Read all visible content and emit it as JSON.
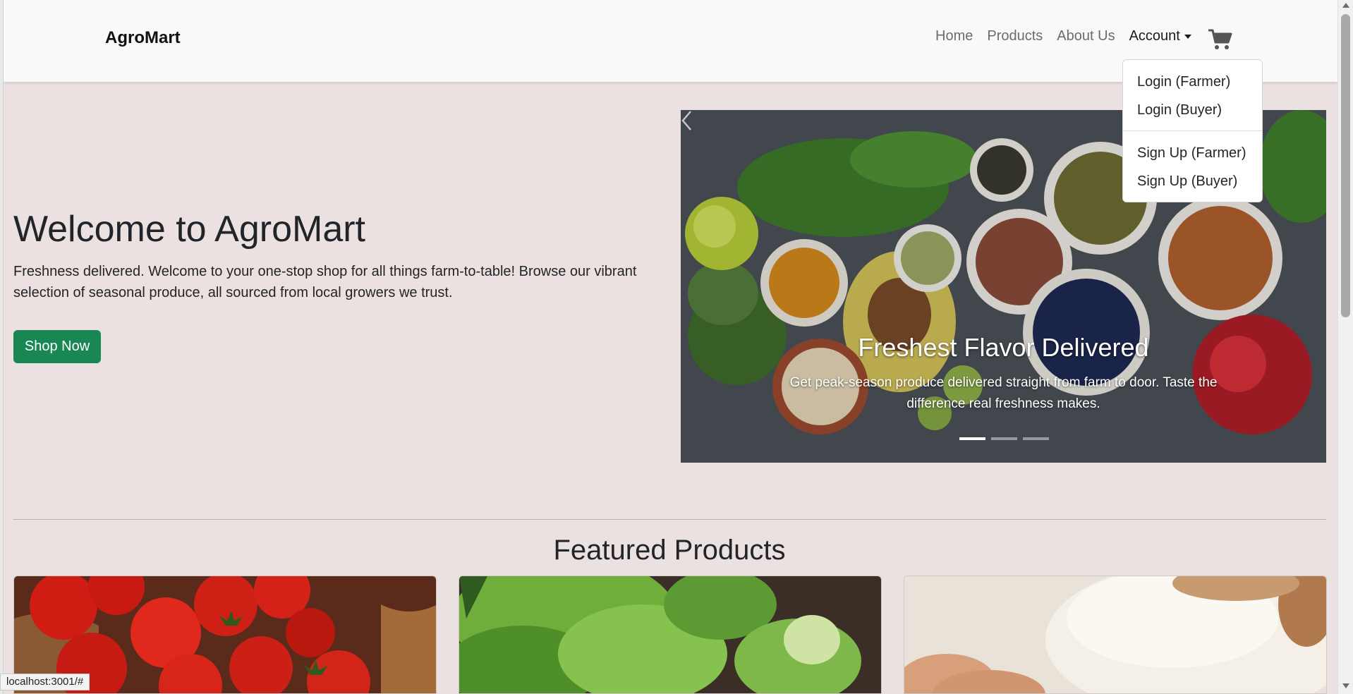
{
  "navbar": {
    "brand": "AgroMart",
    "links": [
      {
        "label": "Home"
      },
      {
        "label": "Products"
      },
      {
        "label": "About Us"
      },
      {
        "label": "Account"
      }
    ],
    "cart_icon": "cart-icon"
  },
  "account_menu": {
    "items": [
      {
        "label": "Login (Farmer)"
      },
      {
        "label": "Login (Buyer)"
      },
      {
        "label": "Sign Up (Farmer)"
      },
      {
        "label": "Sign Up (Buyer)"
      }
    ]
  },
  "hero": {
    "title": "Welcome to AgroMart",
    "text": "Freshness delivered. Welcome to your one-stop shop for all things farm-to-table! Browse our vibrant selection of seasonal produce, all sourced from local growers we trust.",
    "button_label": "Shop Now"
  },
  "carousel": {
    "caption_title": "Freshest Flavor Delivered",
    "caption_text": "Get peak-season produce delivered straight from farm to door. Taste the difference real freshness makes.",
    "slide_count": 3,
    "active_slide": 1
  },
  "featured": {
    "title": "Featured Products",
    "products": [
      {
        "image": "tomatoes-image"
      },
      {
        "image": "lettuce-image"
      },
      {
        "image": "rice-image"
      }
    ]
  },
  "status_bar": {
    "url": "localhost:3001/#"
  },
  "colors": {
    "page_bg": "#ece1e1",
    "navbar_bg": "#f8f9fa",
    "button_green": "#198754"
  }
}
